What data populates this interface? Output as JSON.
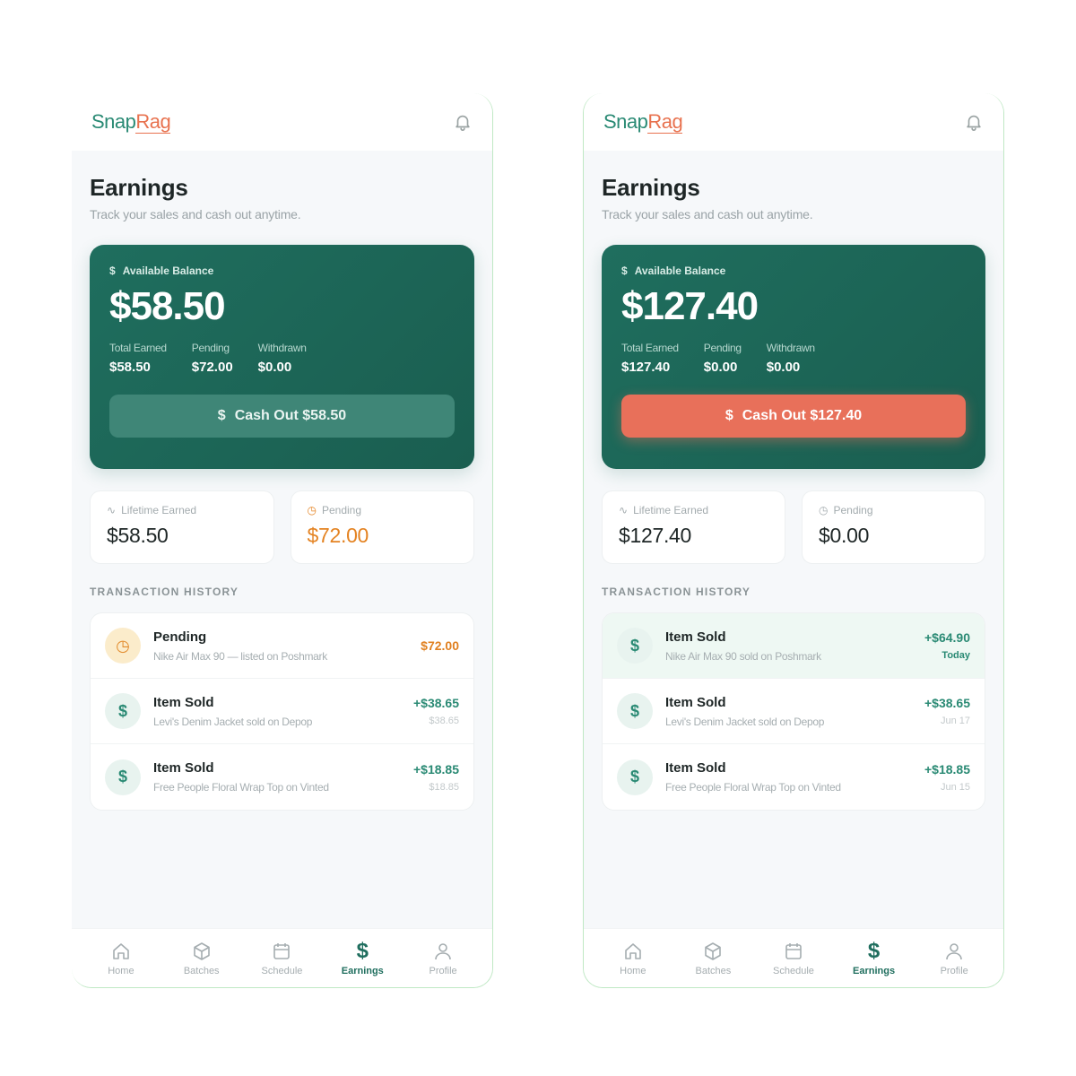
{
  "brand": {
    "snap": "Snap",
    "rag": "Rag"
  },
  "left": {
    "title": "Earnings",
    "subtitle": "Track your sales and cash out anytime.",
    "balance": {
      "label": "Available Balance",
      "amount": "$58.50",
      "stats": [
        {
          "label": "Total Earned",
          "value": "$58.50"
        },
        {
          "label": "Pending",
          "value": "$72.00"
        },
        {
          "label": "Withdrawn",
          "value": "$0.00"
        }
      ],
      "cashout_label": "Cash Out $58.50"
    },
    "lifetime": {
      "label": "Lifetime Earned",
      "value": "$58.50"
    },
    "pending": {
      "label": "Pending",
      "value": "$72.00"
    },
    "history_heading": "TRANSACTION HISTORY",
    "transactions": [
      {
        "title": "Pending",
        "desc": "Nike Air Max 90 — listed on Poshmark",
        "amount": "$72.00",
        "sub": ""
      },
      {
        "title": "Item Sold",
        "desc": "Levi's Denim Jacket sold on Depop",
        "amount": "+$38.65",
        "sub": "$38.65"
      },
      {
        "title": "Item Sold",
        "desc": "Free People Floral Wrap Top on Vinted",
        "amount": "+$18.85",
        "sub": "$18.85"
      }
    ]
  },
  "right": {
    "title": "Earnings",
    "subtitle": "Track your sales and cash out anytime.",
    "balance": {
      "label": "Available Balance",
      "amount": "$127.40",
      "stats": [
        {
          "label": "Total Earned",
          "value": "$127.40"
        },
        {
          "label": "Pending",
          "value": "$0.00"
        },
        {
          "label": "Withdrawn",
          "value": "$0.00"
        }
      ],
      "cashout_label": "Cash Out $127.40"
    },
    "lifetime": {
      "label": "Lifetime Earned",
      "value": "$127.40"
    },
    "pending": {
      "label": "Pending",
      "value": "$0.00"
    },
    "history_heading": "TRANSACTION HISTORY",
    "transactions": [
      {
        "title": "Item Sold",
        "desc": "Nike Air Max 90 sold on Poshmark",
        "amount": "+$64.90",
        "sub": "Today"
      },
      {
        "title": "Item Sold",
        "desc": "Levi's Denim Jacket sold on Depop",
        "amount": "+$38.65",
        "sub": "Jun 17"
      },
      {
        "title": "Item Sold",
        "desc": "Free People Floral Wrap Top on Vinted",
        "amount": "+$18.85",
        "sub": "Jun 15"
      }
    ]
  },
  "nav": [
    {
      "label": "Home",
      "icon": "home-icon"
    },
    {
      "label": "Batches",
      "icon": "box-icon"
    },
    {
      "label": "Schedule",
      "icon": "calendar-icon"
    },
    {
      "label": "Earnings",
      "icon": "dollar-icon"
    },
    {
      "label": "Profile",
      "icon": "user-icon"
    }
  ],
  "colors": {
    "primary": "#1f6e5e",
    "accent": "#e8705a",
    "pending": "#e48322",
    "success": "#2a8a74"
  }
}
